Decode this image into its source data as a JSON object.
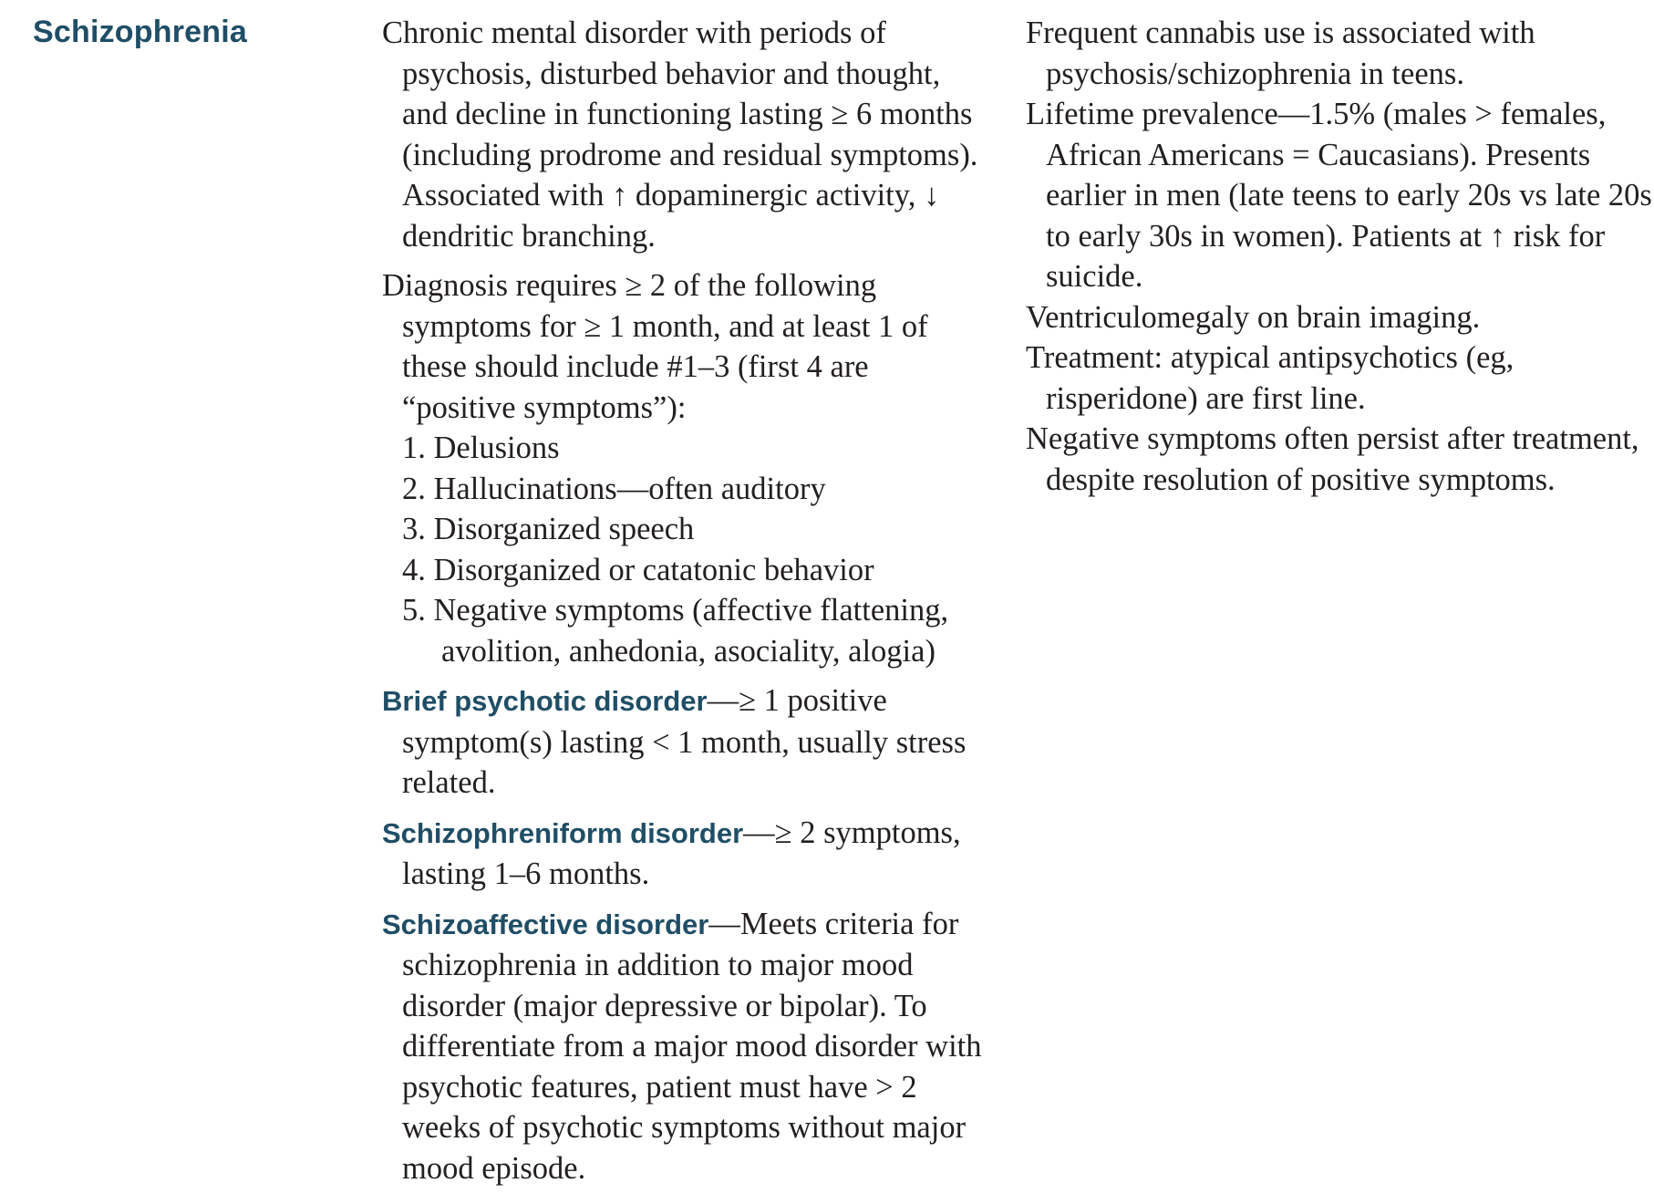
{
  "term": "Schizophrenia",
  "middle_column": {
    "definition": "Chronic mental disorder with periods of psychosis, disturbed behavior and thought, and decline in functioning lasting ≥ 6 months (including prodrome and residual symptoms). Associated with ↑ dopaminergic activity, ↓ dendritic branching.",
    "diagnosis_intro": "Diagnosis requires ≥ 2 of the following symptoms for ≥ 1 month, and at least 1 of these should include #1–3 (first 4 are “positive symptoms”):",
    "symptoms": [
      "1. Delusions",
      "2. Hallucinations—often auditory",
      "3. Disorganized speech",
      "4. Disorganized or catatonic behavior",
      "5. Negative symptoms (affective flattening, avolition, anhedonia, asociality, alogia)"
    ],
    "brief_psychotic": {
      "heading": "Brief psychotic disorder",
      "text": "—≥ 1 positive symptom(s) lasting < 1 month, usually stress related."
    },
    "schizophreniform": {
      "heading": "Schizophreniform disorder",
      "text": "—≥ 2 symptoms, lasting 1–6 months."
    },
    "schizoaffective": {
      "heading": "Schizoaffective disorder",
      "text": "—Meets criteria for schizophrenia in addition to major mood disorder (major depressive or bipolar). To differentiate from a major mood disorder with psychotic features, patient must have > 2 weeks of psychotic symptoms without major mood episode."
    }
  },
  "right_column": [
    "Frequent cannabis use is associated with psychosis/schizophrenia in teens.",
    "Lifetime prevalence—1.5% (males > females, African Americans = Caucasians). Presents earlier in men (late teens to early 20s vs late 20s to early 30s in women). Patients at ↑ risk for suicide.",
    "Ventriculomegaly on brain imaging.",
    "Treatment: atypical antipsychotics (eg, risperidone) are first line.",
    "Negative symptoms often persist after treatment, despite resolution of positive symptoms."
  ]
}
